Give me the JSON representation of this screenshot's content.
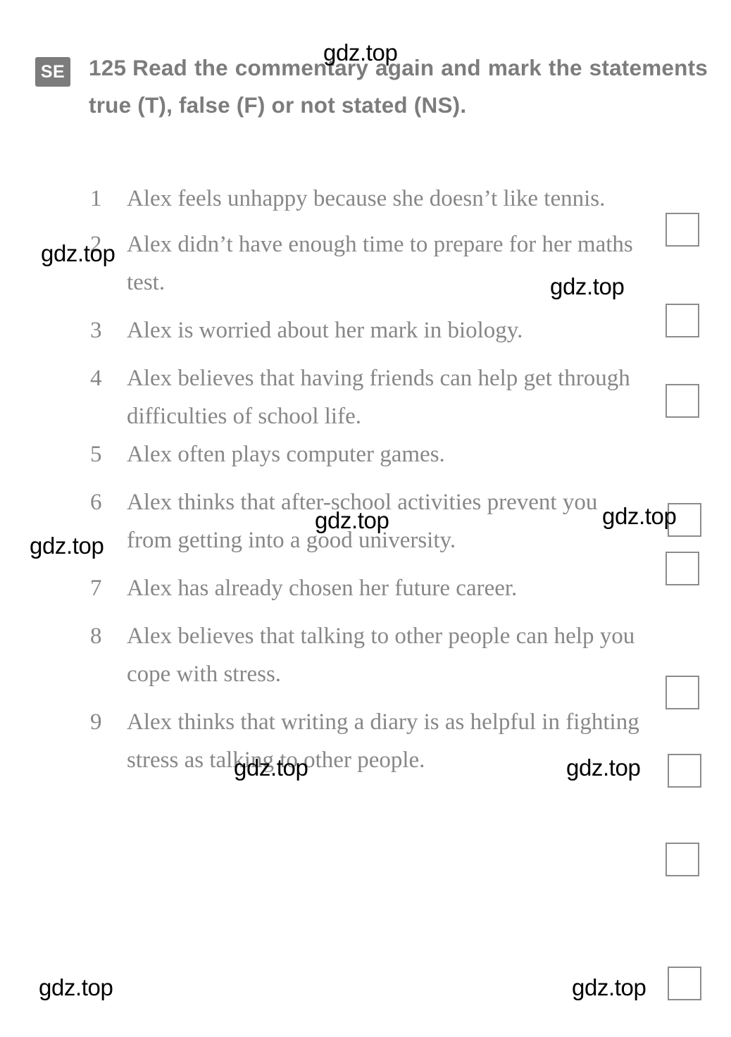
{
  "exercise": {
    "badge": "SE",
    "number": "125",
    "instruction": "Read the commentary again and mark the statements true (T), false (F) or not stated (NS)."
  },
  "statements": [
    {
      "num": "1",
      "text": "Alex feels unhappy because she doesn’t like tennis."
    },
    {
      "num": "2",
      "text": "Alex didn’t have enough time to prepare for her maths test."
    },
    {
      "num": "3",
      "text": "Alex is worried about her mark in biology."
    },
    {
      "num": "4",
      "text": "Alex believes that having friends can help get through difficulties of school life."
    },
    {
      "num": "5",
      "text": "Alex often plays computer games."
    },
    {
      "num": "6",
      "text": "Alex thinks that after-school activities prevent you from getting into a good university."
    },
    {
      "num": "7",
      "text": "Alex has already chosen her future career."
    },
    {
      "num": "8",
      "text": "Alex believes that talking to other people can help you cope with stress."
    },
    {
      "num": "9",
      "text": "Alex thinks that writing a diary is as helpful in fighting stress as talking to other people."
    }
  ],
  "answer_boxes": [
    {
      "label": "answer-box-1"
    },
    {
      "label": "answer-box-2"
    },
    {
      "label": "answer-box-3"
    },
    {
      "label": "answer-box-4"
    },
    {
      "label": "answer-box-5"
    },
    {
      "label": "answer-box-6"
    },
    {
      "label": "answer-box-7"
    },
    {
      "label": "answer-box-8"
    },
    {
      "label": "answer-box-9"
    }
  ],
  "watermarks": [
    {
      "text": "gdz.top"
    },
    {
      "text": "gdz.top"
    },
    {
      "text": "gdz.top"
    },
    {
      "text": "gdz.top"
    },
    {
      "text": "gdz.top"
    },
    {
      "text": "gdz.top"
    },
    {
      "text": "gdz.top"
    },
    {
      "text": "gdz.top"
    },
    {
      "text": "gdz.top"
    },
    {
      "text": "gdz.top"
    },
    {
      "text": "gdz.top"
    },
    {
      "text": "gdz.top"
    }
  ],
  "colors": {
    "badge_bg": "#7c7c7c",
    "heading_text": "#7c7c7c",
    "body_text": "#878787",
    "box_border": "#8c8c8c",
    "watermark": "#000000",
    "page_bg": "#ffffff"
  }
}
